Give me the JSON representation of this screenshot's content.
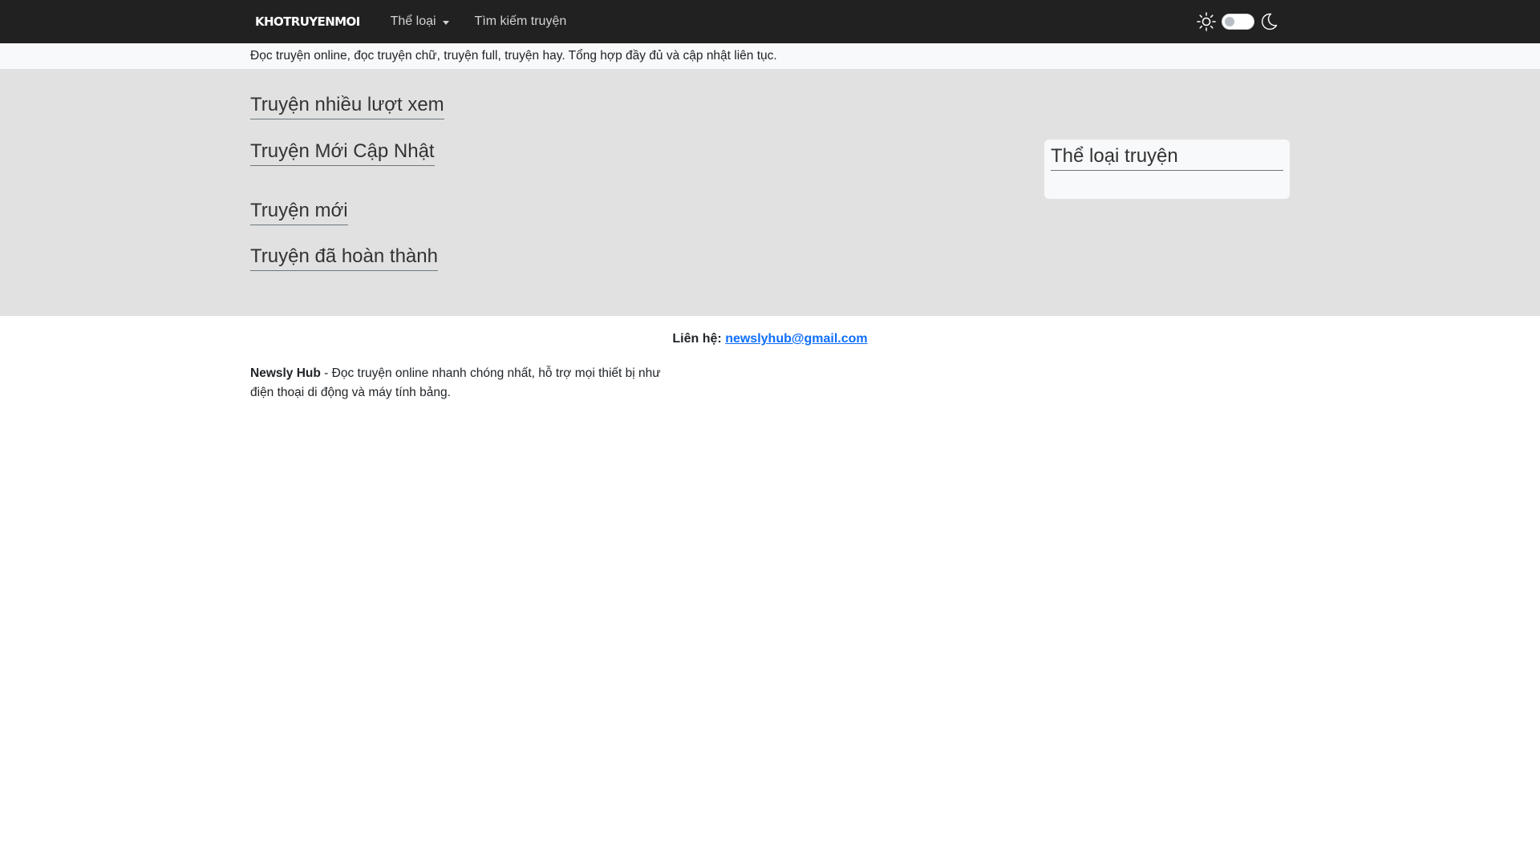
{
  "navbar": {
    "brand": "KHOTRUYENMOI",
    "menu": [
      {
        "label": "Thể loại",
        "has_dropdown": true
      },
      {
        "label": "Tìm kiếm truyện",
        "has_dropdown": false
      }
    ],
    "theme_toggle": {
      "light_icon": "sun-icon",
      "dark_icon": "moon-icon",
      "state": "light"
    }
  },
  "slogan": "Đọc truyện online, đọc truyện chữ, truyện full, truyện hay. Tổng hợp đầy đủ và cập nhật liên tục.",
  "sections": {
    "most_viewed": "Truyện nhiều lượt xem",
    "recently_updated": "Truyện Mới Cập Nhật",
    "new": "Truyện mới",
    "completed": "Truyện đã hoàn thành"
  },
  "sidebar": {
    "title": "Thể loại truyện"
  },
  "footer": {
    "contact_label": "Liên hệ:",
    "contact_email": "newslyhub@gmail.com",
    "site_name": "Newsly Hub",
    "description": "- Đọc truyện online nhanh chóng nhất, hỗ trợ mọi thiết bị như điện thoại di động và máy tính bảng."
  },
  "colors": {
    "navbar_bg": "#212121",
    "main_bg": "#e1e1e1",
    "link": "#0d6efd"
  }
}
